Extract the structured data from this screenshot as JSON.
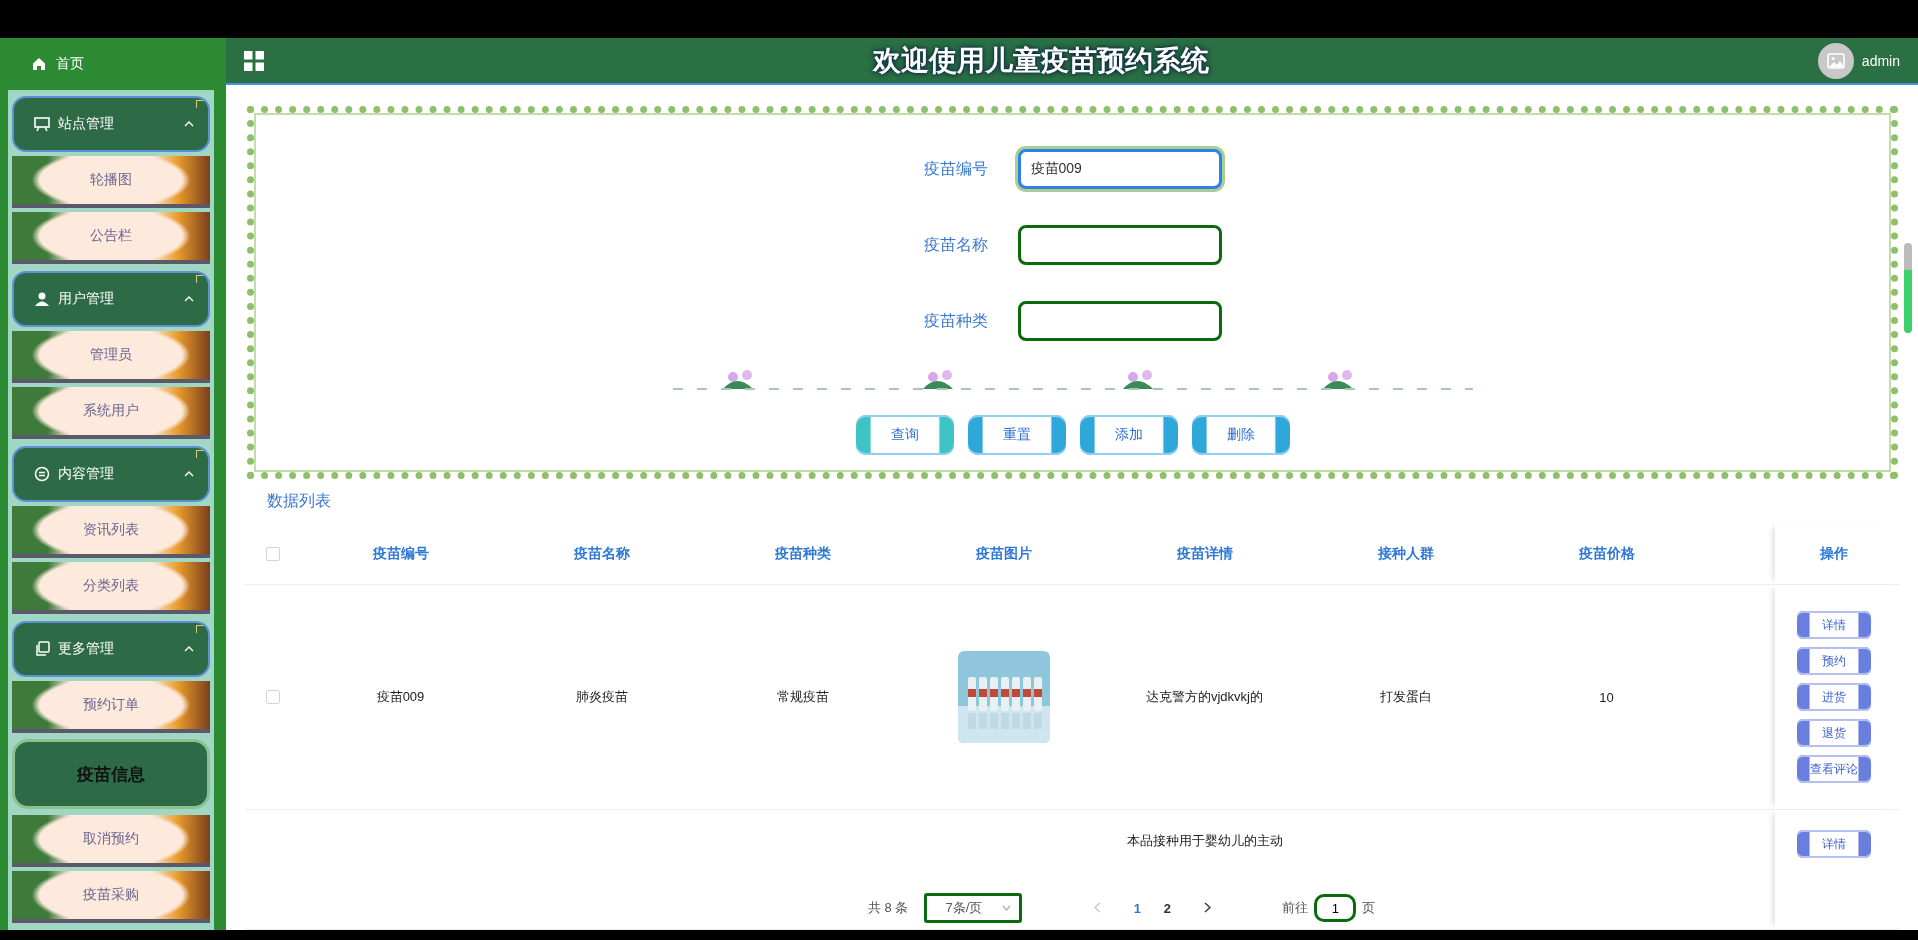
{
  "sidebar": {
    "home": "首页",
    "groups": [
      {
        "label": "站点管理",
        "kind": "board",
        "expanded": true,
        "items": [
          {
            "label": "轮播图",
            "selected": false
          },
          {
            "label": "公告栏",
            "selected": false
          }
        ]
      },
      {
        "label": "用户管理",
        "kind": "user",
        "expanded": true,
        "items": [
          {
            "label": "管理员",
            "selected": false
          },
          {
            "label": "系统用户",
            "selected": false
          }
        ]
      },
      {
        "label": "内容管理",
        "kind": "chat",
        "expanded": true,
        "items": [
          {
            "label": "资讯列表",
            "selected": false
          },
          {
            "label": "分类列表",
            "selected": false
          }
        ]
      },
      {
        "label": "更多管理",
        "kind": "copy",
        "expanded": true,
        "items": [
          {
            "label": "预约订单",
            "selected": false
          },
          {
            "label": "疫苗信息",
            "selected": true
          },
          {
            "label": "取消预约",
            "selected": false
          },
          {
            "label": "疫苗采购",
            "selected": false
          }
        ]
      }
    ]
  },
  "header": {
    "title": "欢迎使用儿童疫苗预约系统",
    "user": "admin"
  },
  "search": {
    "fields": [
      {
        "label": "疫苗编号",
        "value": "疫苗009",
        "focused": true
      },
      {
        "label": "疫苗名称",
        "focused": false
      },
      {
        "label": "疫苗种类",
        "focused": false
      }
    ],
    "buttons": [
      {
        "label": "查询",
        "kind": "teal"
      },
      {
        "label": "重置",
        "kind": "blue"
      },
      {
        "label": "添加",
        "kind": "blue"
      },
      {
        "label": "删除",
        "kind": "blue"
      }
    ]
  },
  "table": {
    "title": "数据列表",
    "select_all_checked": false,
    "columns": [
      "疫苗编号",
      "疫苗名称",
      "疫苗种类",
      "疫苗图片",
      "疫苗详情",
      "接种人群",
      "疫苗价格"
    ],
    "action_column": "操作",
    "rows": [
      {
        "checked": false,
        "cells": [
          "疫苗009",
          "肺炎疫苗",
          "常规疫苗",
          {
            "kind": "picture"
          },
          "达克警方的vjdkvkj的",
          "打发蛋白",
          "10"
        ],
        "actions": [
          "详情",
          "预约",
          "进货",
          "退货",
          "查看评论"
        ]
      },
      {
        "cells": [
          null,
          null,
          null,
          null,
          "本品接种用于婴幼儿的主动",
          null,
          null
        ],
        "actions": [
          "详情"
        ]
      }
    ]
  },
  "pagination": {
    "total": "共 8 条",
    "page_size": "7条/页",
    "prev_disabled": true,
    "pages": [
      {
        "label": "1",
        "selected": true
      },
      {
        "label": "2",
        "selected": false
      }
    ],
    "next_disabled": false,
    "goto_label": "前往",
    "goto_value": "1",
    "goto_suffix": "页"
  }
}
